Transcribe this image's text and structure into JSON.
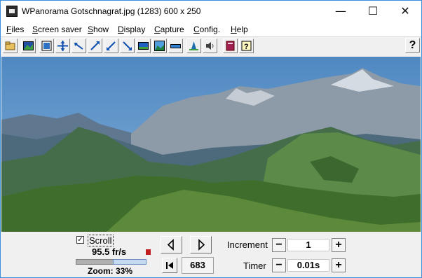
{
  "window": {
    "title": "WPanorama  Gotschnagrat.jpg   (1283) 600 x 250",
    "controls": {
      "minimize": "—",
      "maximize": "☐",
      "close": "✕"
    }
  },
  "menu": [
    {
      "label": "Files",
      "underline": "F",
      "rest": "iles"
    },
    {
      "label": "Screen saver",
      "underline": "S",
      "rest": "creen saver"
    },
    {
      "label": "Show",
      "underline": "S",
      "rest": "how"
    },
    {
      "label": "Display",
      "underline": "D",
      "rest": "isplay"
    },
    {
      "label": "Capture",
      "underline": "C",
      "rest": "apture"
    },
    {
      "label": "Config.",
      "underline": "C",
      "rest": "onfig."
    },
    {
      "label": "Help",
      "underline": "H",
      "rest": "elp"
    }
  ],
  "toolbar": {
    "icons": [
      "open-icon",
      "image-icon",
      "fit-icon",
      "expand-icon",
      "move-left-icon",
      "move-up-right-icon",
      "shrink-icon",
      "move-down-icon",
      "panorama-icon",
      "landscape-icon",
      "flat-icon",
      "pan-icon",
      "sound-icon",
      "book-icon",
      "help-topic-icon"
    ],
    "help_label": "?"
  },
  "controls": {
    "scroll_checked": "✓",
    "scroll_label": "Scroll",
    "fps": "95.5 fr/s",
    "zoom": "Zoom: 33%",
    "zoom_fraction": 0.33,
    "frame_number": "683",
    "increment_label": "Increment",
    "increment_value": "1",
    "timer_label": "Timer",
    "timer_value": "0.01s",
    "minus": "−",
    "plus": "+"
  },
  "colors": {
    "accent": "#3c8ed8",
    "sky": "#5d93c8",
    "grass": "#4a7a30"
  }
}
